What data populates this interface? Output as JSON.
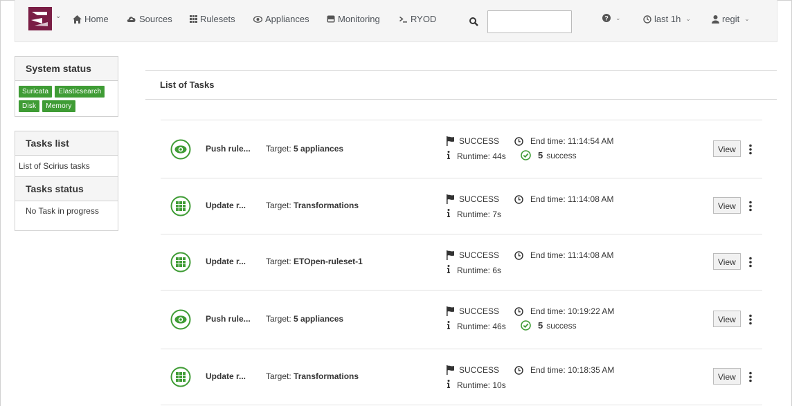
{
  "nav": {
    "home": "Home",
    "sources": "Sources",
    "rulesets": "Rulesets",
    "appliances": "Appliances",
    "monitoring": "Monitoring",
    "ryod": "RYOD",
    "search_value": "",
    "time_range": "last 1h",
    "user": "regit"
  },
  "sidebar": {
    "system_status_title": "System status",
    "badges": [
      "Suricata",
      "Elasticsearch",
      "Disk",
      "Memory"
    ],
    "tasks_list_title": "Tasks list",
    "tasks_list_link": "List of Scirius tasks",
    "tasks_status_title": "Tasks status",
    "tasks_status_text": "No Task in progress"
  },
  "main": {
    "title": "List of Tasks",
    "target_label": "Target:",
    "end_time_label": "End time:",
    "runtime_label": "Runtime:",
    "view_label": "View",
    "tasks": [
      {
        "icon": "eye-icon",
        "name": "Push rule...",
        "target": "5 appliances",
        "status": "SUCCESS",
        "end_time": "11:14:54 AM",
        "runtime": "44s",
        "count": "5",
        "count_label": "success"
      },
      {
        "icon": "grid-icon",
        "name": "Update r...",
        "target": "Transformations",
        "status": "SUCCESS",
        "end_time": "11:14:08 AM",
        "runtime": "7s"
      },
      {
        "icon": "grid-icon",
        "name": "Update r...",
        "target": "ETOpen-ruleset-1",
        "status": "SUCCESS",
        "end_time": "11:14:08 AM",
        "runtime": "6s"
      },
      {
        "icon": "eye-icon",
        "name": "Push rule...",
        "target": "5 appliances",
        "status": "SUCCESS",
        "end_time": "10:19:22 AM",
        "runtime": "46s",
        "count": "5",
        "count_label": "success"
      },
      {
        "icon": "grid-icon",
        "name": "Update r...",
        "target": "Transformations",
        "status": "SUCCESS",
        "end_time": "10:18:35 AM",
        "runtime": "10s"
      }
    ]
  },
  "colors": {
    "brand": "#7a1e45",
    "success": "#3f9c35"
  }
}
